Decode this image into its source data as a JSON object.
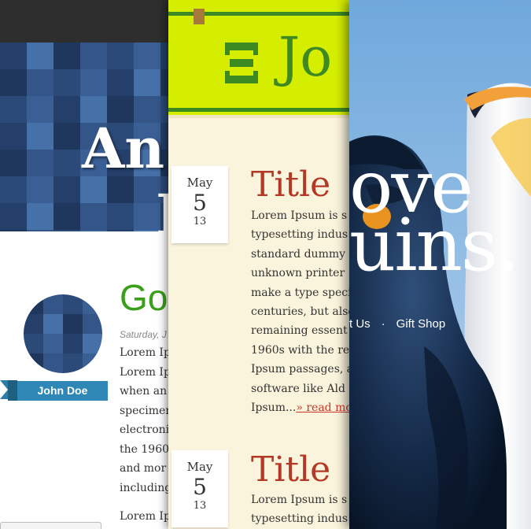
{
  "panel_left": {
    "hero_title_line1": "An",
    "hero_title_line2": "I",
    "author_name": "John Doe",
    "post_title": "Go",
    "post_date": "Saturday, J",
    "post_lines": [
      "Lorem Ip",
      "Lorem Ip",
      "when an",
      "specimen",
      "electroni",
      "the 1960",
      "and  mor",
      "including"
    ],
    "post_next_line": "Lorem Ip",
    "accent_color": "#3aa01a",
    "ribbon_color": "#2e87b5"
  },
  "panel_middle": {
    "logo_text": "Jo",
    "header_color": "#d5ee00",
    "articles": [
      {
        "month": "May",
        "day": "5",
        "year": "13",
        "title": "Title",
        "lines": [
          "Lorem Ipsum is s",
          "typesetting indus",
          "standard dummy",
          "unknown printer",
          "make a type speci",
          "centuries, but also",
          "remaining essent",
          "1960s with the re",
          "Ipsum passages, a",
          "software like Ald"
        ],
        "last_line": "Ipsum...",
        "read_more": "» read mo"
      },
      {
        "month": "May",
        "day": "5",
        "year": "13",
        "title": "Title",
        "lines": [
          "Lorem Ipsum is s",
          "typesetting indus"
        ]
      }
    ]
  },
  "panel_right": {
    "headline_line1": "ove",
    "headline_line2": "uins.",
    "nav_items": [
      "t Us",
      "Gift Shop"
    ],
    "nav_separator": "·"
  }
}
